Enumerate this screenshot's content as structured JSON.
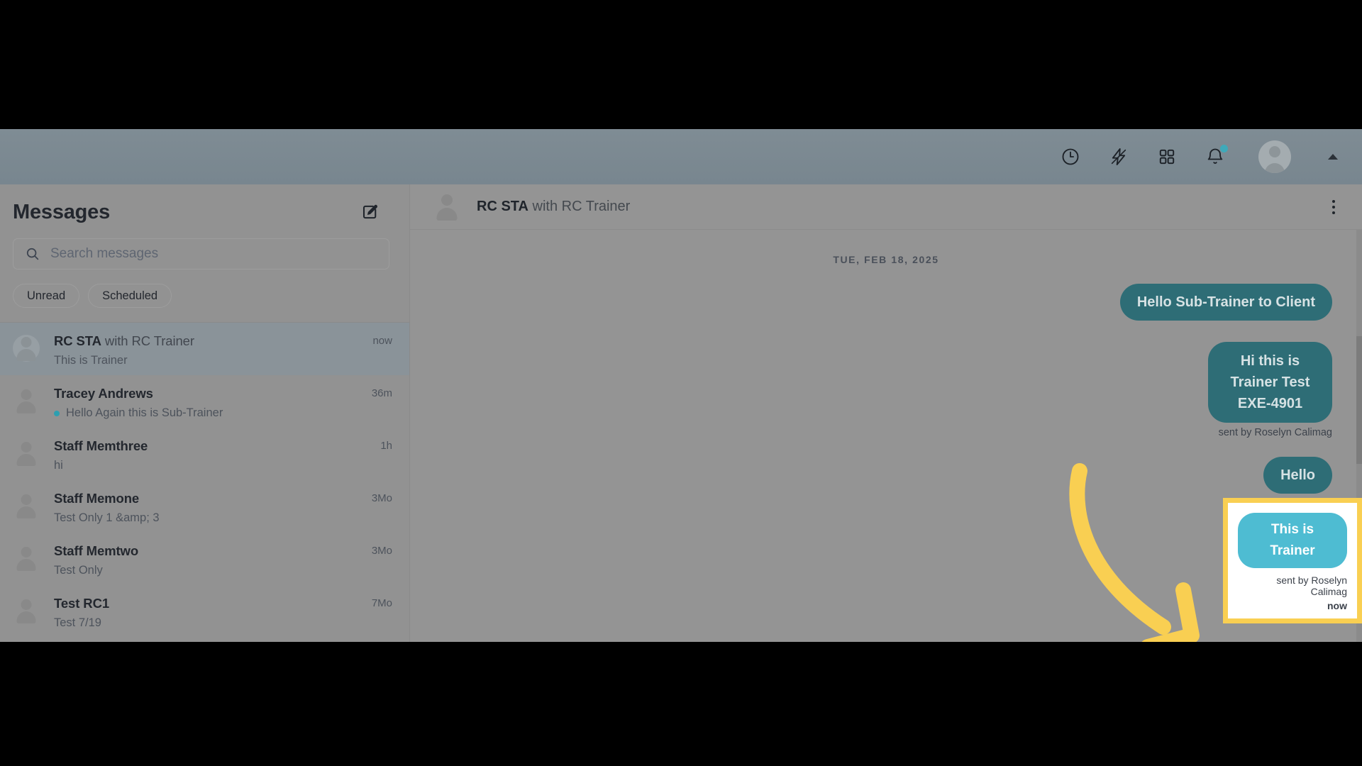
{
  "topbar": {
    "icons": [
      {
        "name": "clock-history-icon",
        "label": "Activity history"
      },
      {
        "name": "lightning-bolt-icon",
        "label": "Quick actions"
      },
      {
        "name": "apps-grid-icon",
        "label": "Apps"
      },
      {
        "name": "bell-icon",
        "label": "Notifications"
      }
    ],
    "notification_dot_color": "#3fa9b9",
    "avatar_name": "user-avatar"
  },
  "sidebar": {
    "title": "Messages",
    "compose_icon": "compose-edit-icon",
    "search": {
      "placeholder": "Search messages",
      "value": "",
      "icon": "search-icon"
    },
    "filters": [
      {
        "label": "Unread",
        "active": false
      },
      {
        "label": "Scheduled",
        "active": false
      }
    ],
    "conversations": [
      {
        "name": "RC STA",
        "with": " with RC Trainer",
        "preview": "This is Trainer",
        "time": "now",
        "unread": false,
        "active": true
      },
      {
        "name": "Tracey Andrews",
        "with": "",
        "preview": "Hello Again this is Sub-Trainer",
        "time": "36m",
        "unread": true,
        "active": false
      },
      {
        "name": "Staff Memthree",
        "with": "",
        "preview": "hi",
        "time": "1h",
        "unread": false,
        "active": false
      },
      {
        "name": "Staff Memone",
        "with": "",
        "preview": "Test Only 1 &amp; 3",
        "time": "3Mo",
        "unread": false,
        "active": false
      },
      {
        "name": "Staff Memtwo",
        "with": "",
        "preview": "Test Only",
        "time": "3Mo",
        "unread": false,
        "active": false
      },
      {
        "name": "Test RC1",
        "with": "",
        "preview": "Test 7/19",
        "time": "7Mo",
        "unread": false,
        "active": false
      }
    ]
  },
  "chat": {
    "header": {
      "name": "RC STA",
      "with": " with RC Trainer",
      "menu_icon": "kebab-menu-icon"
    },
    "date_separator": "TUE, FEB 18, 2025",
    "messages": [
      {
        "text": "Hello Sub-Trainer to Client",
        "sender": "outgoing",
        "sent_by": "",
        "time": "",
        "highlighted": false
      },
      {
        "text": "Hi this is Trainer Test EXE-4901",
        "sender": "outgoing",
        "sent_by": "sent by Roselyn Calimag",
        "time": "",
        "highlighted": false
      },
      {
        "text": "Hello",
        "sender": "outgoing",
        "sent_by": "",
        "time": "",
        "highlighted": false
      }
    ],
    "highlighted_message": {
      "text": "This is Trainer",
      "sent_by": "sent by Roselyn Calimag",
      "time": "now",
      "bubble_color": "#4ebcd2",
      "highlight_border_color": "#f9cf52"
    }
  },
  "annotation": {
    "arrow_color": "#f9cf52",
    "arrow_name": "attention-arrow"
  },
  "colors": {
    "topbar_bg": "#7f8c94",
    "sidebar_bg": "#929292",
    "chat_bg": "#949494",
    "bubble_teal": "#2e6d76",
    "accent_teal": "#3fa9b9",
    "highlight_yellow": "#f9cf52"
  }
}
